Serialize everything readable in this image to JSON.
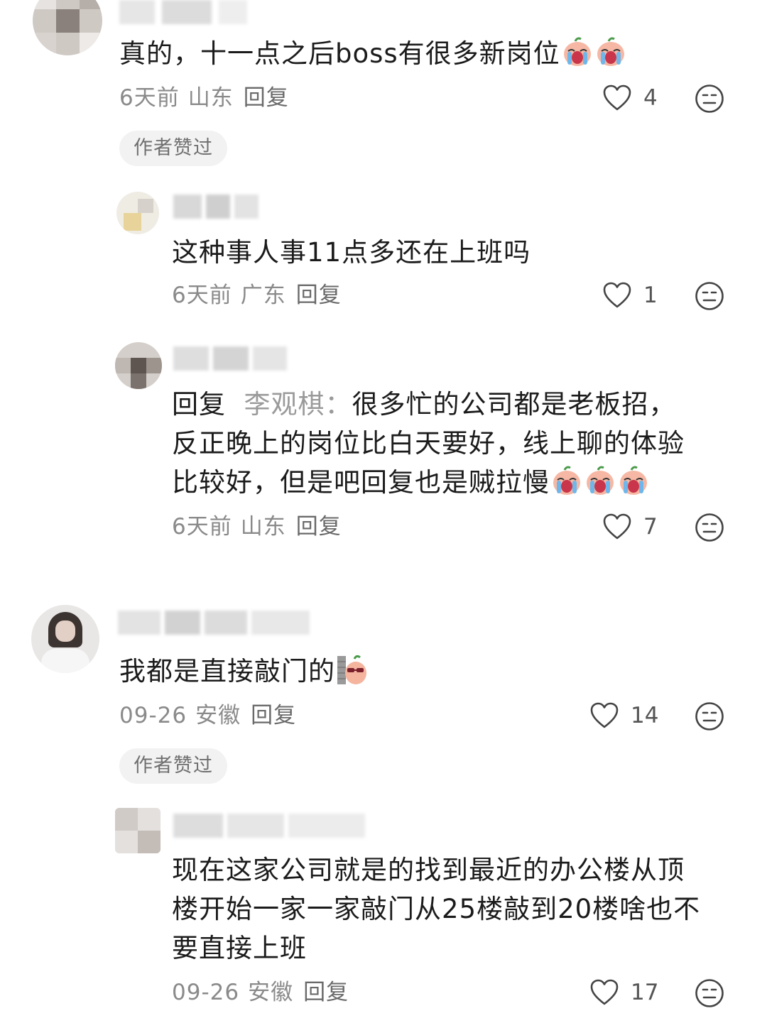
{
  "comments": [
    {
      "text": "真的，十一点之后boss有很多新岗位",
      "time": "6天前",
      "location": "山东",
      "reply_label": "回复",
      "likes": "4",
      "author_liked_label": "作者赞过",
      "replies": [
        {
          "text": "这种事人事11点多还在上班吗",
          "time": "6天前",
          "location": "广东",
          "reply_label": "回复",
          "likes": "1"
        },
        {
          "reply_prefix": "回复",
          "reply_target": "李观棋：",
          "text_line1": "很多忙的公司都是老板招，",
          "text_line2": "反正晚上的岗位比白天要好，线上聊的体验",
          "text_line3": "比较好，但是吧回复也是贼拉慢",
          "time": "6天前",
          "location": "山东",
          "reply_label": "回复",
          "likes": "7"
        }
      ]
    },
    {
      "text": "我都是直接敲门的",
      "time": "09-26",
      "location": "安徽",
      "reply_label": "回复",
      "likes": "14",
      "author_liked_label": "作者赞过",
      "replies": [
        {
          "text_line1": "现在这家公司就是的找到最近的办公楼从顶",
          "text_line2": "楼开始一家一家敲门从25楼敲到20楼啥也不",
          "text_line3": "要直接上班",
          "time": "09-26",
          "location": "安徽",
          "reply_label": "回复",
          "likes": "17"
        }
      ]
    }
  ],
  "icons": {
    "like": "heart-outline-icon",
    "reaction": "neutral-face-icon",
    "emoji_crying": "crying-peach-emoji",
    "emoji_wall": "peeking-wall-emoji"
  },
  "colors": {
    "text": "#1b1b1b",
    "meta": "#8a8a8a",
    "reply_target": "#9a9a9a",
    "pill_bg": "#f2f2f2",
    "icon": "#444444"
  }
}
